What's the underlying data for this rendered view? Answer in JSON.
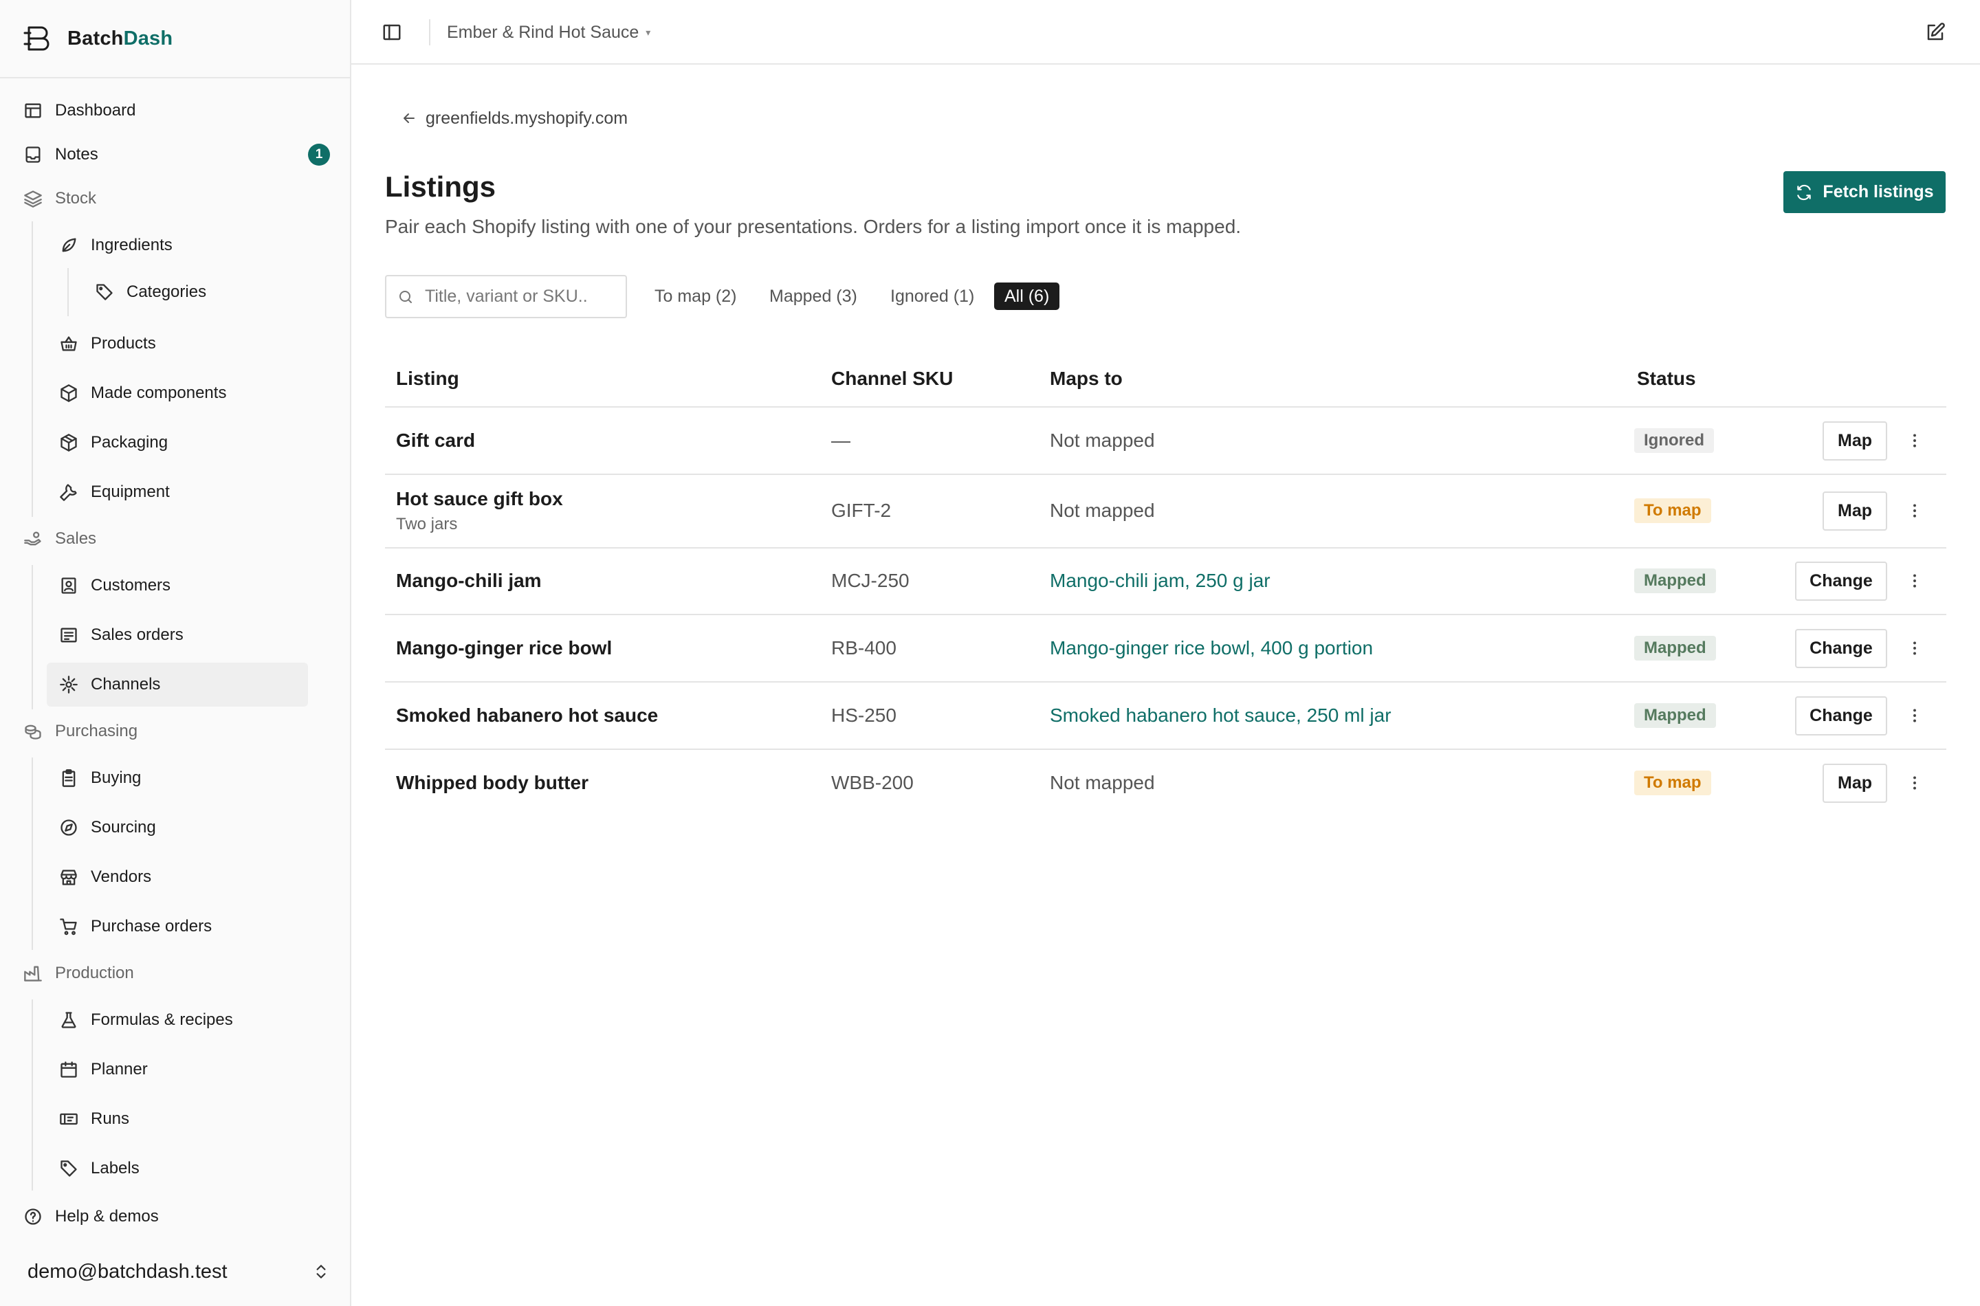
{
  "brand": {
    "name_prefix": "Batch",
    "name_accent": "Dash"
  },
  "nav": {
    "dashboard": "Dashboard",
    "notes": "Notes",
    "notes_badge": "1",
    "stock": "Stock",
    "ingredients": "Ingredients",
    "categories": "Categories",
    "products": "Products",
    "made_components": "Made components",
    "packaging": "Packaging",
    "equipment": "Equipment",
    "sales": "Sales",
    "customers": "Customers",
    "sales_orders": "Sales orders",
    "channels": "Channels",
    "purchasing": "Purchasing",
    "buying": "Buying",
    "sourcing": "Sourcing",
    "vendors": "Vendors",
    "purchase_orders": "Purchase orders",
    "production": "Production",
    "formulas": "Formulas & recipes",
    "planner": "Planner",
    "runs": "Runs",
    "labels": "Labels",
    "help": "Help & demos",
    "active": "Channels"
  },
  "account": {
    "email": "demo@batchdash.test"
  },
  "topbar": {
    "workspace": "Ember & Rind Hot Sauce",
    "workspace_caret": "▾"
  },
  "page": {
    "back_label": "greenfields.myshopify.com",
    "title": "Listings",
    "subtitle": "Pair each Shopify listing with one of your presentations. Orders for a listing import once it is mapped.",
    "fetch_button": "Fetch listings"
  },
  "search": {
    "placeholder": "Title, variant or SKU.."
  },
  "filters": [
    {
      "label": "To map (2)",
      "active": false
    },
    {
      "label": "Mapped (3)",
      "active": false
    },
    {
      "label": "Ignored (1)",
      "active": false
    },
    {
      "label": "All (6)",
      "active": true
    }
  ],
  "table": {
    "columns": [
      "Listing",
      "Channel SKU",
      "Maps to",
      "Status"
    ],
    "rows": [
      {
        "listing": "Gift card",
        "variant": "",
        "sku": "—",
        "maps_to": "Not mapped",
        "linked": false,
        "status": "Ignored",
        "action": "Map"
      },
      {
        "listing": "Hot sauce gift box",
        "variant": "Two jars",
        "sku": "GIFT-2",
        "maps_to": "Not mapped",
        "linked": false,
        "status": "To map",
        "action": "Map"
      },
      {
        "listing": "Mango-chili jam",
        "variant": "",
        "sku": "MCJ-250",
        "maps_to": "Mango-chili jam, 250 g jar",
        "linked": true,
        "status": "Mapped",
        "action": "Change"
      },
      {
        "listing": "Mango-ginger rice bowl",
        "variant": "",
        "sku": "RB-400",
        "maps_to": "Mango-ginger rice bowl, 400 g portion",
        "linked": true,
        "status": "Mapped",
        "action": "Change"
      },
      {
        "listing": "Smoked habanero hot sauce",
        "variant": "",
        "sku": "HS-250",
        "maps_to": "Smoked habanero hot sauce, 250 ml jar",
        "linked": true,
        "status": "Mapped",
        "action": "Change"
      },
      {
        "listing": "Whipped body butter",
        "variant": "",
        "sku": "WBB-200",
        "maps_to": "Not mapped",
        "linked": false,
        "status": "To map",
        "action": "Map"
      }
    ]
  },
  "colors": {
    "accent": "#0f6e67",
    "to_map": "#d07a00",
    "mapped": "#557a5e",
    "ignored": "#666666"
  }
}
